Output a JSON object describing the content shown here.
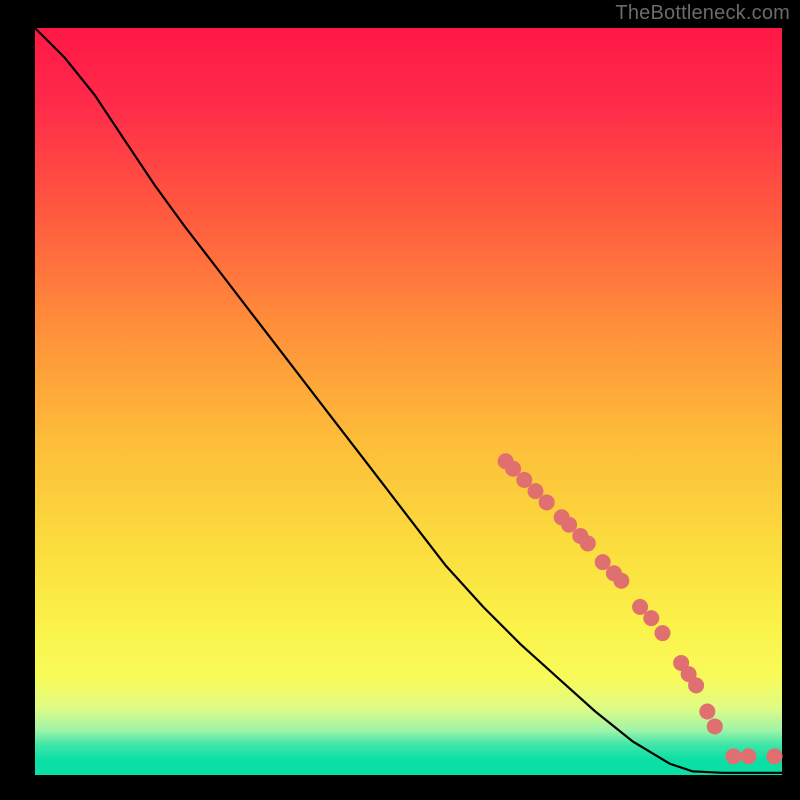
{
  "attribution": "TheBottleneck.com",
  "chart_data": {
    "type": "line",
    "title": "",
    "xlabel": "",
    "ylabel": "",
    "xlim": [
      0,
      100
    ],
    "ylim": [
      0,
      100
    ],
    "curve": [
      {
        "x": 0,
        "y": 100
      },
      {
        "x": 4,
        "y": 96
      },
      {
        "x": 8,
        "y": 91
      },
      {
        "x": 12,
        "y": 85
      },
      {
        "x": 16,
        "y": 79
      },
      {
        "x": 20,
        "y": 73.5
      },
      {
        "x": 25,
        "y": 67
      },
      {
        "x": 30,
        "y": 60.5
      },
      {
        "x": 35,
        "y": 54
      },
      {
        "x": 40,
        "y": 47.5
      },
      {
        "x": 45,
        "y": 41
      },
      {
        "x": 50,
        "y": 34.5
      },
      {
        "x": 55,
        "y": 28
      },
      {
        "x": 60,
        "y": 22.5
      },
      {
        "x": 65,
        "y": 17.5
      },
      {
        "x": 70,
        "y": 13
      },
      {
        "x": 75,
        "y": 8.5
      },
      {
        "x": 80,
        "y": 4.5
      },
      {
        "x": 85,
        "y": 1.5
      },
      {
        "x": 88,
        "y": 0.5
      },
      {
        "x": 92,
        "y": 0.3
      },
      {
        "x": 96,
        "y": 0.3
      },
      {
        "x": 100,
        "y": 0.3
      }
    ],
    "points": [
      {
        "x": 63,
        "y": 42
      },
      {
        "x": 64,
        "y": 41
      },
      {
        "x": 65.5,
        "y": 39.5
      },
      {
        "x": 67,
        "y": 38
      },
      {
        "x": 68.5,
        "y": 36.5
      },
      {
        "x": 70.5,
        "y": 34.5
      },
      {
        "x": 71.5,
        "y": 33.5
      },
      {
        "x": 73,
        "y": 32
      },
      {
        "x": 74,
        "y": 31
      },
      {
        "x": 76,
        "y": 28.5
      },
      {
        "x": 77.5,
        "y": 27
      },
      {
        "x": 78.5,
        "y": 26
      },
      {
        "x": 81,
        "y": 22.5
      },
      {
        "x": 82.5,
        "y": 21
      },
      {
        "x": 84,
        "y": 19
      },
      {
        "x": 86.5,
        "y": 15
      },
      {
        "x": 87.5,
        "y": 13.5
      },
      {
        "x": 88.5,
        "y": 12
      },
      {
        "x": 90,
        "y": 8.5
      },
      {
        "x": 91,
        "y": 6.5
      },
      {
        "x": 93.5,
        "y": 2.5
      },
      {
        "x": 95.5,
        "y": 2.5
      },
      {
        "x": 99,
        "y": 2.5
      }
    ],
    "point_color": "#e07070",
    "point_radius_px": 8
  }
}
